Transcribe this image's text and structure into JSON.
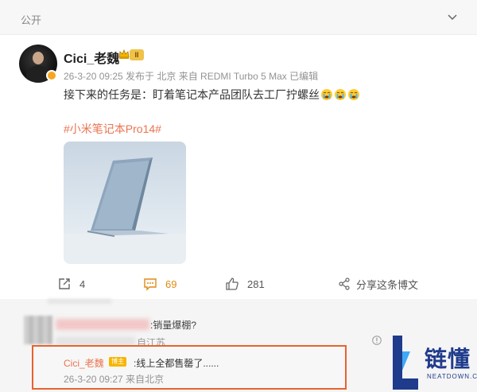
{
  "header": {
    "visibility": "公开"
  },
  "post": {
    "author": "Cici_老魏",
    "level": "II",
    "meta": "26-3-20 09:25 发布于 北京 来自 REDMI Turbo 5 Max 已编辑",
    "text": "接下来的任务是：盯着笔记本产品团队去工厂拧螺丝",
    "emoji_names": [
      "crying-emoji",
      "crying-emoji",
      "crying-emoji"
    ],
    "hashtag": "#小米笔记本Pro14#",
    "image_icon": "laptop-photo"
  },
  "actions": {
    "repost_count": "4",
    "comment_count": "69",
    "like_count": "281",
    "share_label": "分享这条博文"
  },
  "comments": {
    "first_reply_text": ":销量爆棚?",
    "first_reply_location": "自江苏",
    "sub_reply": {
      "author": "Cici_老魏",
      "badge": "博主",
      "text": ":线上全都售罄了......",
      "meta": "26-3-20 09:27 来自北京"
    }
  },
  "watermark": {
    "name_cn": "链懂",
    "name_en": "NEATDOWN.COM"
  },
  "colors": {
    "accent": "#eb7350",
    "highlight_border": "#e8632f",
    "brand_blue": "#1f3b8c"
  }
}
